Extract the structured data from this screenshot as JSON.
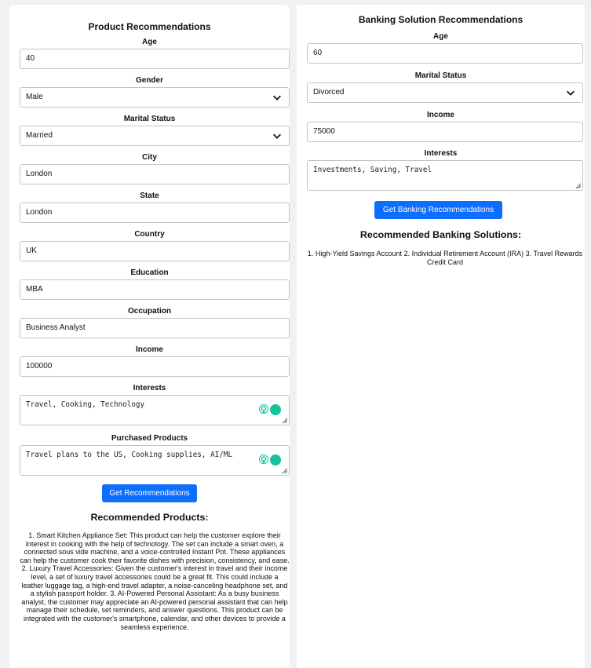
{
  "product": {
    "title": "Product Recommendations",
    "age_label": "Age",
    "age_value": "40",
    "gender_label": "Gender",
    "gender_value": "Male",
    "marital_label": "Marital Status",
    "marital_value": "Married",
    "city_label": "City",
    "city_value": "London",
    "state_label": "State",
    "state_value": "London",
    "country_label": "Country",
    "country_value": "UK",
    "education_label": "Education",
    "education_value": "MBA",
    "occupation_label": "Occupation",
    "occupation_value": "Business Analyst",
    "income_label": "Income",
    "income_value": "100000",
    "interests_label": "Interests",
    "interests_value": "Travel, Cooking, Technology",
    "purchased_label": "Purchased Products",
    "purchased_value": "Travel plans to the US, Cooking supplies, AI/ML",
    "button_label": "Get Recommendations",
    "results_title": "Recommended Products:",
    "results_text": "1. Smart Kitchen Appliance Set: This product can help the customer explore their interest in cooking with the help of technology. The set can include a smart oven, a connected sous vide machine, and a voice-controlled Instant Pot. These appliances can help the customer cook their favorite dishes with precision, consistency, and ease. 2. Luxury Travel Accessories: Given the customer's interest in travel and their income level, a set of luxury travel accessories could be a great fit. This could include a leather luggage tag, a high-end travel adapter, a noise-canceling headphone set, and a stylish passport holder. 3. AI-Powered Personal Assistant: As a busy business analyst, the customer may appreciate an AI-powered personal assistant that can help manage their schedule, set reminders, and answer questions. This product can be integrated with the customer's smartphone, calendar, and other devices to provide a seamless experience."
  },
  "banking": {
    "title": "Banking Solution Recommendations",
    "age_label": "Age",
    "age_value": "60",
    "marital_label": "Marital Status",
    "marital_value": "Divorced",
    "income_label": "Income",
    "income_value": "75000",
    "interests_label": "Interests",
    "interests_value": "Investments, Saving, Travel",
    "button_label": "Get Banking Recommendations",
    "results_title": "Recommended Banking Solutions:",
    "results_text": "1. High-Yield Savings Account 2. Individual Retirement Account (IRA) 3. Travel Rewards Credit Card"
  },
  "icons": {
    "dropdown": "chevron-down-icon",
    "resize": "resize-handle-icon",
    "assistant": "grammarly-icon",
    "idea": "lightbulb-icon"
  },
  "colors": {
    "button": "#0d6efd",
    "grammarly": "#15c39a"
  }
}
